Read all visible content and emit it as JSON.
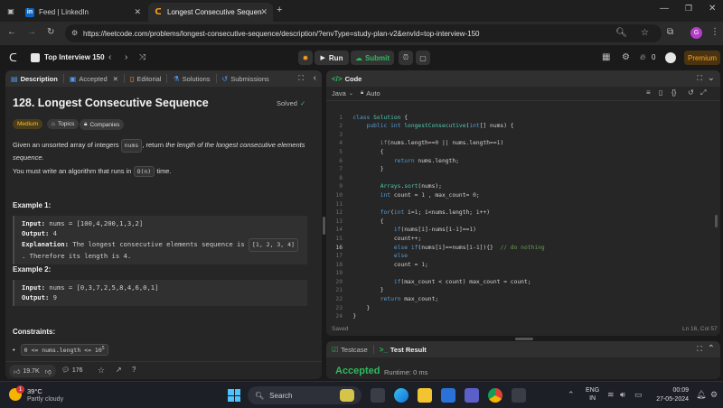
{
  "browser": {
    "tabs": [
      {
        "label": "Feed | LinkedIn",
        "icon": "linkedin-icon",
        "active": false
      },
      {
        "label": "Longest Consecutive Sequence",
        "icon": "leetcode-icon",
        "active": true
      }
    ],
    "url": "https://leetcode.com/problems/longest-consecutive-sequence/description/?envType=study-plan-v2&envId=top-interview-150",
    "profile_initial": "G"
  },
  "leetcode_bar": {
    "study_plan": "Top Interview 150",
    "run": "Run",
    "submit": "Submit",
    "streak": "0",
    "premium": "Premium"
  },
  "problem": {
    "tabs": [
      "Description",
      "Accepted",
      "Editorial",
      "Solutions",
      "Submissions"
    ],
    "title": "128. Longest Consecutive Sequence",
    "status": "Solved",
    "difficulty": "Medium",
    "topics": "Topics",
    "companies": "Companies",
    "p1a": "Given an unsorted array of integers",
    "p1code": "nums",
    "p1b": ", return",
    "p1em": "the length of the longest consecutive elements sequence.",
    "p2a": "You must write an algorithm that runs in",
    "p2code": "O(n)",
    "p2b": "time.",
    "ex1_title": "Example 1:",
    "ex1_input_label": "Input:",
    "ex1_input": "nums = [100,4,200,1,3,2]",
    "ex1_output_label": "Output:",
    "ex1_output": "4",
    "ex1_expl_label": "Explanation:",
    "ex1_expl_a": "The longest consecutive elements sequence is",
    "ex1_expl_chip": "[1, 2, 3, 4]",
    "ex1_expl_b": ". Therefore its length is 4.",
    "ex2_title": "Example 2:",
    "ex2_input_label": "Input:",
    "ex2_input": "nums = [0,3,7,2,5,8,4,6,0,1]",
    "ex2_output_label": "Output:",
    "ex2_output": "9",
    "constraints_title": "Constraints:",
    "constraint1": "0 <= nums.length <= 10",
    "constraint1_sup": "5",
    "likes": "19.7K",
    "comments": "176"
  },
  "editor": {
    "header": "Code",
    "language": "Java",
    "mode": "Auto",
    "saved": "Saved",
    "cursor": "Ln 16, Col 57"
  },
  "bottom": {
    "tab_testcase": "Testcase",
    "tab_result": "Test Result",
    "verdict": "Accepted",
    "runtime": "Runtime: 0 ms"
  },
  "taskbar": {
    "weather_temp": "39°C",
    "weather_desc": "Partly cloudy",
    "search": "Search",
    "lang": "ENG",
    "region": "IN",
    "time": "00:09",
    "date": "27-05-2024",
    "notif_count": "1"
  }
}
